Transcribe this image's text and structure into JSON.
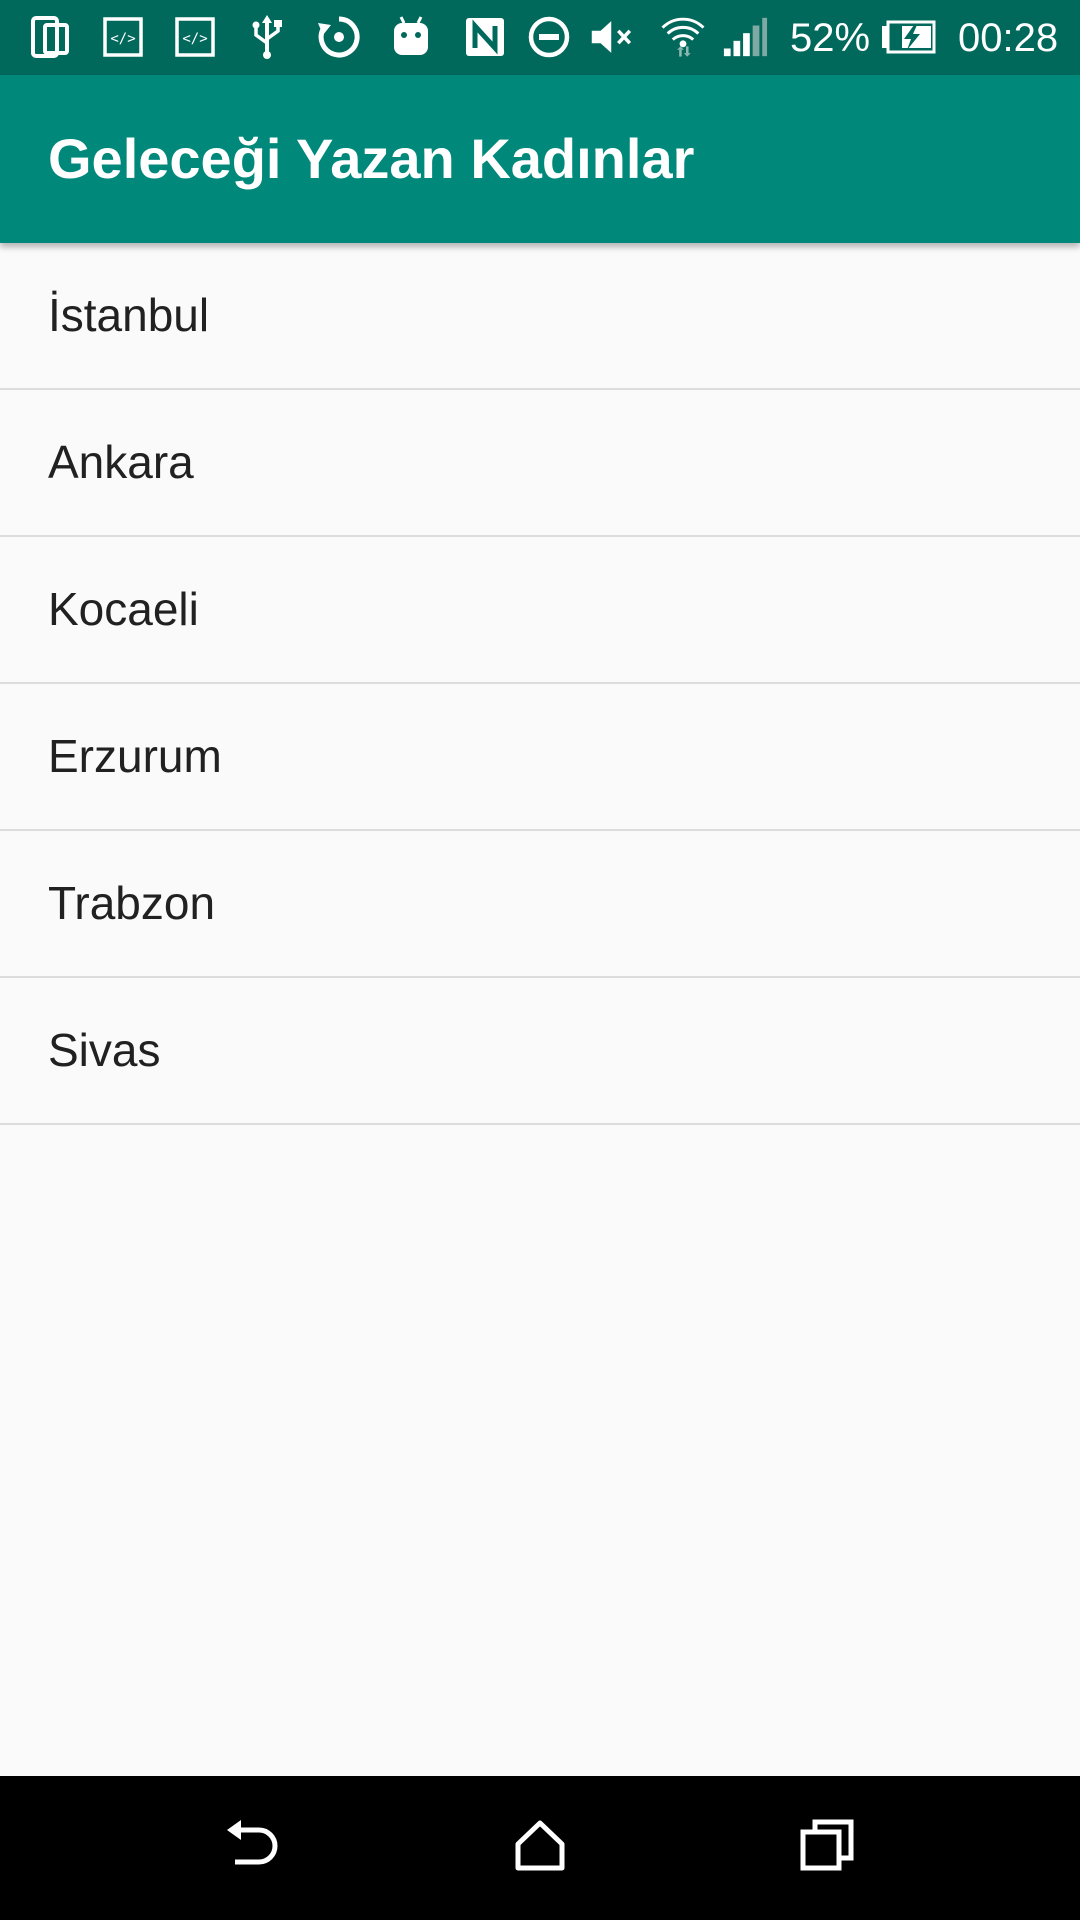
{
  "status_bar": {
    "battery_percent_text": "52%",
    "time": "00:28",
    "icons": [
      "device-tablet-icon",
      "developer-code-icon",
      "developer-code-icon",
      "usb-icon",
      "sync-icon",
      "android-icon",
      "nfc-icon",
      "do-not-disturb-icon",
      "volume-muted-icon",
      "wifi-icon",
      "cellular-signal-icon",
      "battery-charging-icon"
    ]
  },
  "app_bar": {
    "title": "Geleceği Yazan Kadınlar"
  },
  "cities": [
    {
      "label": "İstanbul"
    },
    {
      "label": "Ankara"
    },
    {
      "label": "Kocaeli"
    },
    {
      "label": "Erzurum"
    },
    {
      "label": "Trabzon"
    },
    {
      "label": "Sivas"
    }
  ],
  "nav_bar": {
    "icons": [
      "back-icon",
      "home-icon",
      "recents-icon"
    ]
  },
  "colors": {
    "status_bar": "#00695c",
    "app_bar": "#00897b",
    "background": "#fafafa",
    "divider": "#dcdcdc",
    "list_text": "#212121",
    "nav_bar": "#000000"
  }
}
